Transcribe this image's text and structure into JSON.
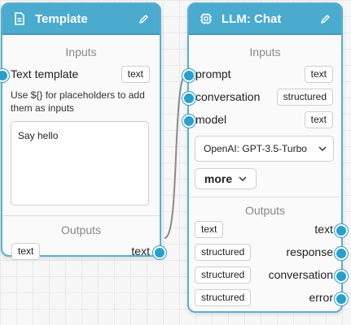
{
  "template_node": {
    "title": "Template",
    "inputs_label": "Inputs",
    "input": {
      "label": "Text template",
      "type": "text"
    },
    "hint": "Use ${} for placeholders to add them as inputs",
    "textarea_value": "Say hello",
    "outputs_label": "Outputs",
    "output": {
      "label": "text",
      "type": "text"
    }
  },
  "llm_node": {
    "title": "LLM: Chat",
    "inputs_label": "Inputs",
    "inputs": [
      {
        "label": "prompt",
        "type": "text"
      },
      {
        "label": "conversation",
        "type": "structured"
      },
      {
        "label": "model",
        "type": "text"
      }
    ],
    "model_select": "OpenAI: GPT-3.5-Turbo",
    "more_label": "more",
    "outputs_label": "Outputs",
    "outputs": [
      {
        "label": "text",
        "type": "text"
      },
      {
        "label": "response",
        "type": "structured"
      },
      {
        "label": "conversation",
        "type": "structured"
      },
      {
        "label": "error",
        "type": "structured"
      }
    ]
  },
  "colors": {
    "accent": "#4aabcf",
    "handle": "#2a9fcc",
    "edge": "#8a8a8a"
  }
}
